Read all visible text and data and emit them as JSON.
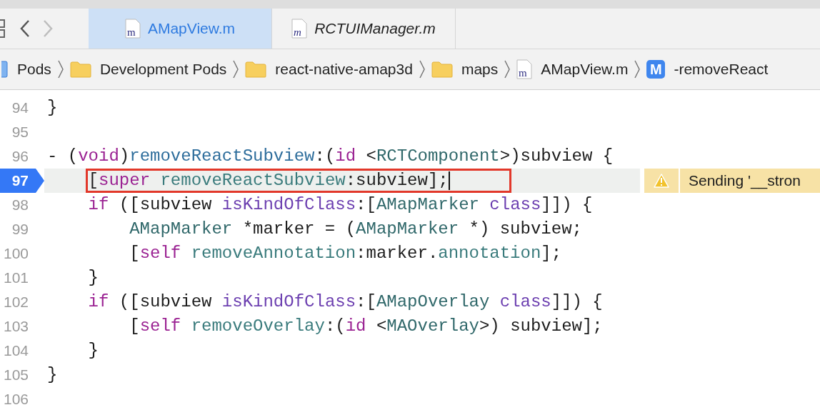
{
  "navigation": {
    "back_enabled": true,
    "forward_enabled": false
  },
  "tabs": [
    {
      "label": "AMapView.m",
      "icon_letter": "m",
      "selected": true,
      "preview": false
    },
    {
      "label": "RCTUIManager.m",
      "icon_letter": "m",
      "selected": false,
      "preview": true
    }
  ],
  "breadcrumbs": [
    {
      "kind": "project",
      "label": "Pods"
    },
    {
      "kind": "folder",
      "label": "Development Pods"
    },
    {
      "kind": "folder",
      "label": "react-native-amap3d"
    },
    {
      "kind": "folder",
      "label": "maps"
    },
    {
      "kind": "file",
      "icon_letter": "m",
      "label": "AMapView.m"
    },
    {
      "kind": "method",
      "icon_letter": "M",
      "label": "-removeReact"
    }
  ],
  "editor": {
    "lines": [
      {
        "number": "94",
        "current": false,
        "outlined": false,
        "tokens": [
          {
            "kind": "plain",
            "text": "}"
          }
        ]
      },
      {
        "number": "95",
        "current": false,
        "outlined": false
      },
      {
        "number": "96",
        "current": false,
        "outlined": false,
        "tokens": [
          {
            "kind": "plain",
            "text": "- ("
          },
          {
            "kind": "keyword",
            "text": "void"
          },
          {
            "kind": "plain",
            "text": ")"
          },
          {
            "kind": "declaration",
            "text": "removeReactSubview"
          },
          {
            "kind": "plain",
            "text": ":("
          },
          {
            "kind": "keyword",
            "text": "id"
          },
          {
            "kind": "plain",
            "text": " <"
          },
          {
            "kind": "type",
            "text": "RCTComponent"
          },
          {
            "kind": "plain",
            "text": ">)subview {"
          }
        ]
      },
      {
        "number": "97",
        "current": true,
        "outlined": true,
        "warning": "Sending '__stron",
        "tokens": [
          {
            "kind": "plain",
            "text": "    ["
          },
          {
            "kind": "keyword",
            "text": "super "
          },
          {
            "kind": "method",
            "text": "removeReactSubview"
          },
          {
            "kind": "plain",
            "text": ":subview];"
          }
        ]
      },
      {
        "number": "98",
        "current": false,
        "outlined": false,
        "tokens": [
          {
            "kind": "keyword",
            "text": "    if"
          },
          {
            "kind": "plain",
            "text": " ([subview "
          },
          {
            "kind": "system",
            "text": "isKindOfClass"
          },
          {
            "kind": "plain",
            "text": ":["
          },
          {
            "kind": "type",
            "text": "AMapMarker "
          },
          {
            "kind": "system",
            "text": "class"
          },
          {
            "kind": "plain",
            "text": "]]) {"
          }
        ]
      },
      {
        "number": "99",
        "current": false,
        "outlined": false,
        "tokens": [
          {
            "kind": "type",
            "text": "        AMapMarker"
          },
          {
            "kind": "plain",
            "text": " *marker = ("
          },
          {
            "kind": "type",
            "text": "AMapMarker"
          },
          {
            "kind": "plain",
            "text": " *) subview;"
          }
        ]
      },
      {
        "number": "100",
        "current": false,
        "outlined": false,
        "tokens": [
          {
            "kind": "plain",
            "text": "        ["
          },
          {
            "kind": "keyword",
            "text": "self "
          },
          {
            "kind": "method",
            "text": "removeAnnotation"
          },
          {
            "kind": "plain",
            "text": ":marker."
          },
          {
            "kind": "method",
            "text": "annotation"
          },
          {
            "kind": "plain",
            "text": "];"
          }
        ]
      },
      {
        "number": "101",
        "current": false,
        "outlined": false,
        "tokens": [
          {
            "kind": "plain",
            "text": "    }"
          }
        ]
      },
      {
        "number": "102",
        "current": false,
        "outlined": false,
        "tokens": [
          {
            "kind": "keyword",
            "text": "    if"
          },
          {
            "kind": "plain",
            "text": " ([subview "
          },
          {
            "kind": "system",
            "text": "isKindOfClass"
          },
          {
            "kind": "plain",
            "text": ":["
          },
          {
            "kind": "type",
            "text": "AMapOverlay "
          },
          {
            "kind": "system",
            "text": "class"
          },
          {
            "kind": "plain",
            "text": "]]) {"
          }
        ]
      },
      {
        "number": "103",
        "current": false,
        "outlined": false,
        "tokens": [
          {
            "kind": "plain",
            "text": "        ["
          },
          {
            "kind": "keyword",
            "text": "self "
          },
          {
            "kind": "method",
            "text": "removeOverlay"
          },
          {
            "kind": "plain",
            "text": ":("
          },
          {
            "kind": "keyword",
            "text": "id"
          },
          {
            "kind": "plain",
            "text": " <"
          },
          {
            "kind": "type",
            "text": "MAOverlay"
          },
          {
            "kind": "plain",
            "text": ">) subview];"
          }
        ]
      },
      {
        "number": "104",
        "current": false,
        "outlined": false,
        "tokens": [
          {
            "kind": "plain",
            "text": "    }"
          }
        ]
      },
      {
        "number": "105",
        "current": false,
        "outlined": false,
        "tokens": [
          {
            "kind": "plain",
            "text": "}"
          }
        ]
      },
      {
        "number": "106",
        "current": false,
        "outlined": false
      }
    ]
  }
}
